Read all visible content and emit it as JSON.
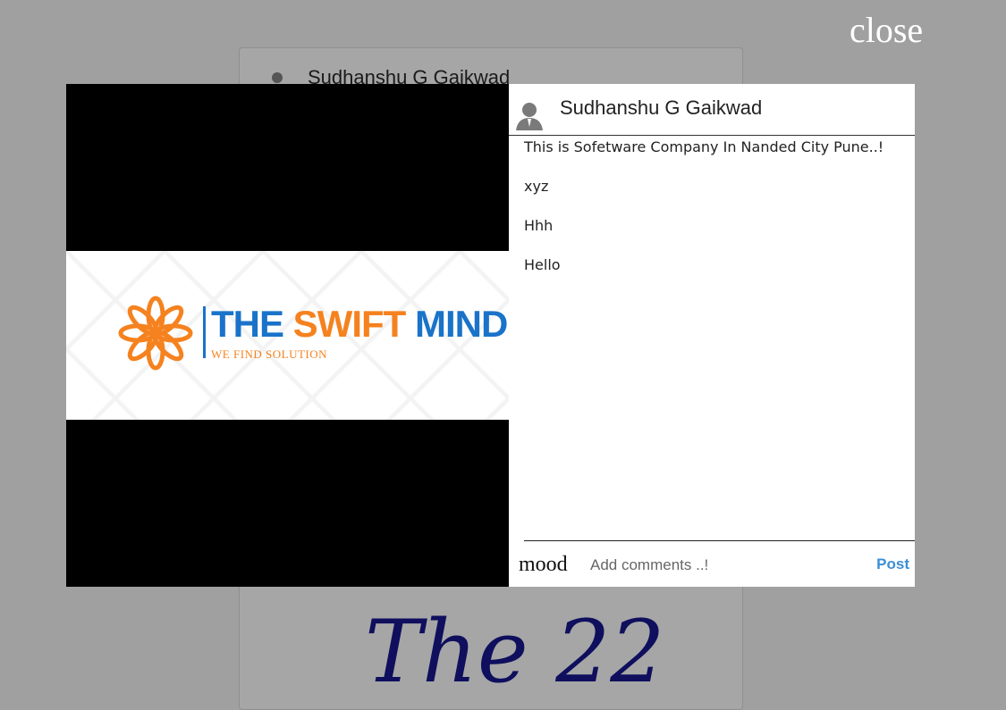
{
  "background_card": {
    "author_name": "Sudhanshu G Gaikwad",
    "image_text": "The 22"
  },
  "overlay": {
    "close_label": "close"
  },
  "modal": {
    "logo": {
      "title_part1": "THE ",
      "title_part2": "SWIFT",
      "title_part3": " MIND",
      "subtitle": "WE FIND SOLUTION"
    },
    "author_name": "Sudhanshu G Gaikwad",
    "comments": [
      "This is Sofetware Company In Nanded City Pune..!",
      "xyz",
      "Hhh",
      "Hello"
    ],
    "comment_box": {
      "mood_label": "mood",
      "placeholder": "Add comments ..!",
      "value": "",
      "post_label": "Post"
    }
  },
  "colors": {
    "brand_blue": "#1a73c9",
    "brand_orange": "#f5821f",
    "post_blue": "#3a8fd6"
  }
}
